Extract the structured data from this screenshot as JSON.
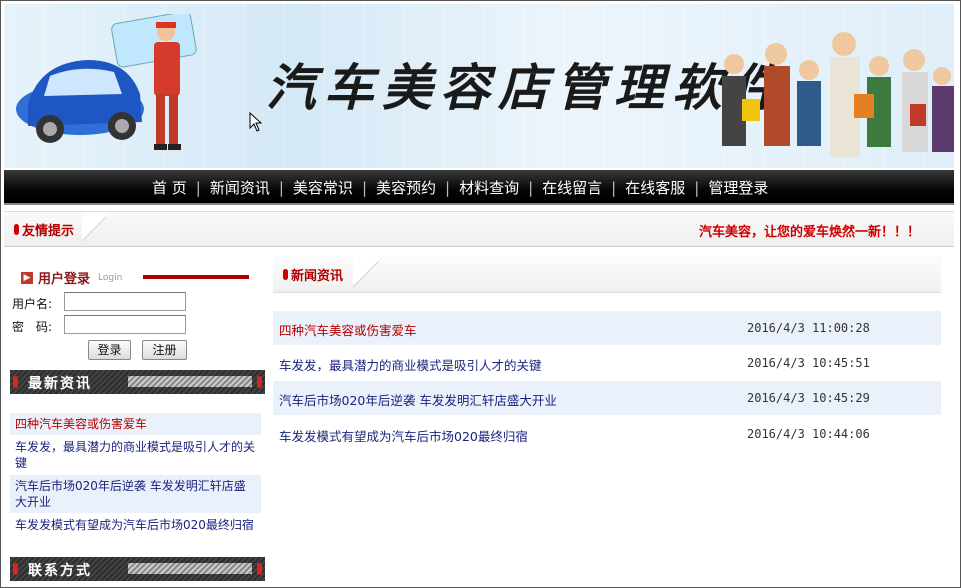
{
  "banner": {
    "title": "汽车美容店管理软件"
  },
  "nav": {
    "items": [
      "首 页",
      "新闻资讯",
      "美容常识",
      "美容预约",
      "材料查询",
      "在线留言",
      "在线客服",
      "管理登录"
    ]
  },
  "notice": {
    "label": "友情提示",
    "message": "汽车美容，让您的爱车焕然一新！！！"
  },
  "login": {
    "title": "用户登录",
    "subtitle": "Login",
    "username_label": "用户名:",
    "password_label": "密　码:",
    "login_button": "登录",
    "register_button": "注册"
  },
  "latest": {
    "title": "最新资讯",
    "items": [
      "四种汽车美容或伤害爱车",
      "车发发，最具潜力的商业模式是吸引人才的关键",
      "汽车后市场020年后逆袭 车发发明汇轩店盛大开业",
      "车发发模式有望成为汽车后市场020最终归宿"
    ]
  },
  "contact": {
    "title": "联系方式"
  },
  "news": {
    "title": "新闻资讯",
    "rows": [
      {
        "title": "四种汽车美容或伤害爱车",
        "date": "2016/4/3 11:00:28"
      },
      {
        "title": "车发发，最具潜力的商业模式是吸引人才的关键",
        "date": "2016/4/3 10:45:51"
      },
      {
        "title": "汽车后市场020年后逆袭 车发发明汇轩店盛大开业",
        "date": "2016/4/3 10:45:29"
      },
      {
        "title": "车发发模式有望成为汽车后市场020最终归宿",
        "date": "2016/4/3 10:44:06"
      }
    ]
  },
  "colors": {
    "accent_red": "#b50000",
    "link_blue": "#1a237e",
    "nav_bg": "#000000",
    "row_alt": "#eaf1fb"
  }
}
